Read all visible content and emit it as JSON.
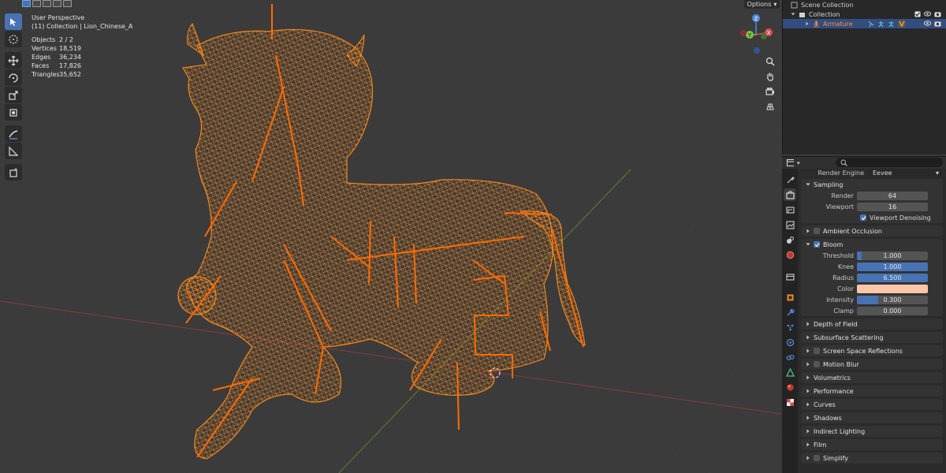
{
  "viewport": {
    "perspective": "User Perspective",
    "collection_line": "(11) Collection | Lion_Chinese_A",
    "stats": [
      {
        "label": "Objects",
        "value": "2 / 2"
      },
      {
        "label": "Vertices",
        "value": "18,519"
      },
      {
        "label": "Edges",
        "value": "36,234"
      },
      {
        "label": "Faces",
        "value": "17,826"
      },
      {
        "label": "Triangles",
        "value": "35,652"
      }
    ],
    "options_label": "Options",
    "gizmo": {
      "x": "X",
      "y": "Y",
      "z": "Z"
    },
    "tools": [
      "select-box-icon",
      "cursor-icon",
      "move-icon",
      "rotate-icon",
      "scale-icon",
      "transform-icon",
      "annotate-icon",
      "measure-icon",
      "add-cube-icon"
    ],
    "colors": {
      "wire": "#ff8c1a",
      "bone": "#ff6a00",
      "x_axis": "#9a3b3b",
      "y_axis": "#6e8e3a"
    }
  },
  "outliner": {
    "scene_collection": "Scene Collection",
    "collection": "Collection",
    "armature": "Armature"
  },
  "properties": {
    "render_engine_label": "Render Engine",
    "render_engine_value": "Eevee",
    "sampling": {
      "title": "Sampling",
      "render_label": "Render",
      "render_value": "64",
      "viewport_label": "Viewport",
      "viewport_value": "16",
      "denoise_label": "Viewport Denoising"
    },
    "ambient_occlusion": "Ambient Occlusion",
    "bloom": {
      "title": "Bloom",
      "threshold_label": "Threshold",
      "threshold_value": "1.000",
      "knee_label": "Knee",
      "knee_value": "1.000",
      "knee_fill": 1.0,
      "radius_label": "Radius",
      "radius_value": "6.500",
      "radius_fill": 1.0,
      "color_label": "Color",
      "color_value": "#ffc7a8",
      "intensity_label": "Intensity",
      "intensity_value": "0.300",
      "intensity_fill": 0.3,
      "clamp_label": "Clamp",
      "clamp_value": "0.000"
    },
    "panels": [
      {
        "title": "Depth of Field",
        "checkbox": false
      },
      {
        "title": "Subsurface Scattering",
        "checkbox": false
      },
      {
        "title": "Screen Space Reflections",
        "checkbox": true
      },
      {
        "title": "Motion Blur",
        "checkbox": true
      },
      {
        "title": "Volumetrics",
        "checkbox": false
      },
      {
        "title": "Performance",
        "checkbox": false
      },
      {
        "title": "Curves",
        "checkbox": false
      },
      {
        "title": "Shadows",
        "checkbox": false
      },
      {
        "title": "Indirect Lighting",
        "checkbox": false
      },
      {
        "title": "Film",
        "checkbox": false
      },
      {
        "title": "Simplify",
        "checkbox": true
      }
    ]
  }
}
